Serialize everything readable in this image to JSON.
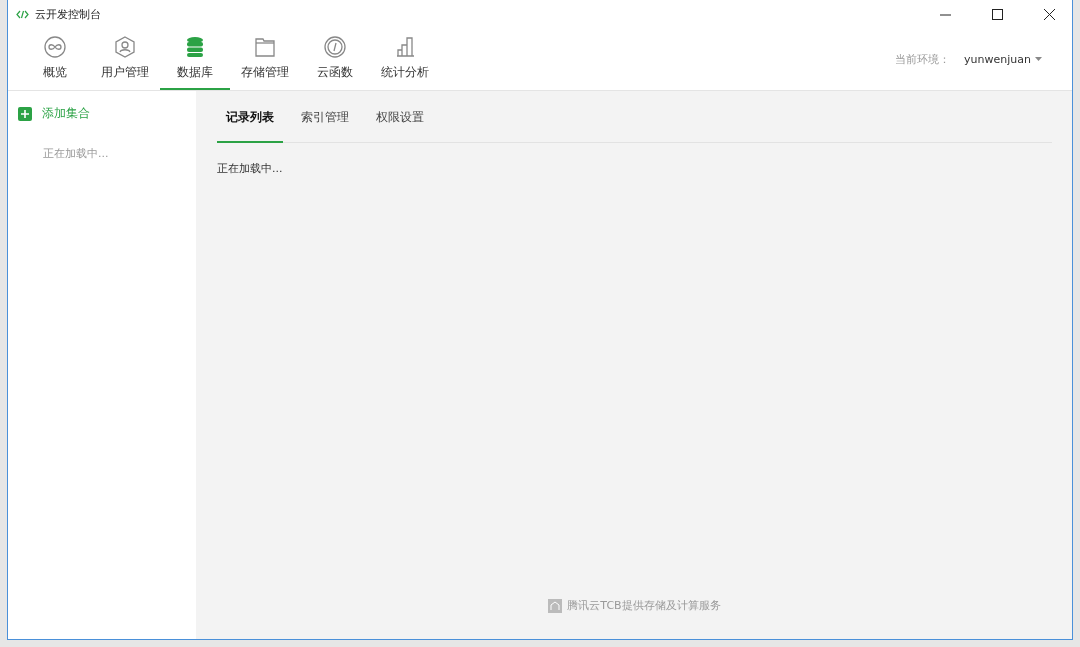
{
  "window": {
    "title": "云开发控制台"
  },
  "nav": [
    {
      "label": "概览",
      "selected": false
    },
    {
      "label": "用户管理",
      "selected": false
    },
    {
      "label": "数据库",
      "selected": true
    },
    {
      "label": "存储管理",
      "selected": false
    },
    {
      "label": "云函数",
      "selected": false
    },
    {
      "label": "统计分析",
      "selected": false
    }
  ],
  "environment": {
    "label": "当前环境：",
    "value": "yunwenjuan"
  },
  "sidebar": {
    "add_button": "添加集合",
    "status": "正在加载中..."
  },
  "tabs": [
    {
      "label": "记录列表",
      "selected": true
    },
    {
      "label": "索引管理",
      "selected": false
    },
    {
      "label": "权限设置",
      "selected": false
    }
  ],
  "content": {
    "status": "正在加载中..."
  },
  "footer": "腾讯云TCB提供存储及计算服务"
}
